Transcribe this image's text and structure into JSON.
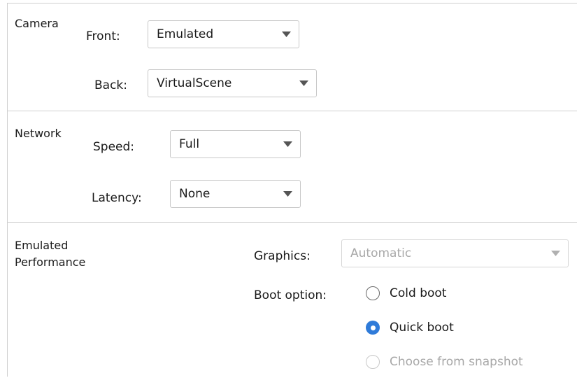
{
  "camera": {
    "title": "Camera",
    "front_label": "Front:",
    "front_value": "Emulated",
    "back_label": "Back:",
    "back_value": "VirtualScene"
  },
  "network": {
    "title": "Network",
    "speed_label": "Speed:",
    "speed_value": "Full",
    "latency_label": "Latency:",
    "latency_value": "None"
  },
  "performance": {
    "title_line1": "Emulated",
    "title_line2": "Performance",
    "graphics_label": "Graphics:",
    "graphics_value": "Automatic",
    "graphics_enabled": false,
    "boot_label": "Boot option:",
    "boot_options": [
      {
        "label": "Cold boot",
        "selected": false,
        "enabled": true
      },
      {
        "label": "Quick boot",
        "selected": true,
        "enabled": true
      },
      {
        "label": "Choose from snapshot",
        "selected": false,
        "enabled": false
      }
    ]
  },
  "colors": {
    "accent": "#2f7bd9",
    "border": "#cfcfcf",
    "disabled_text": "#a8a8a8"
  }
}
